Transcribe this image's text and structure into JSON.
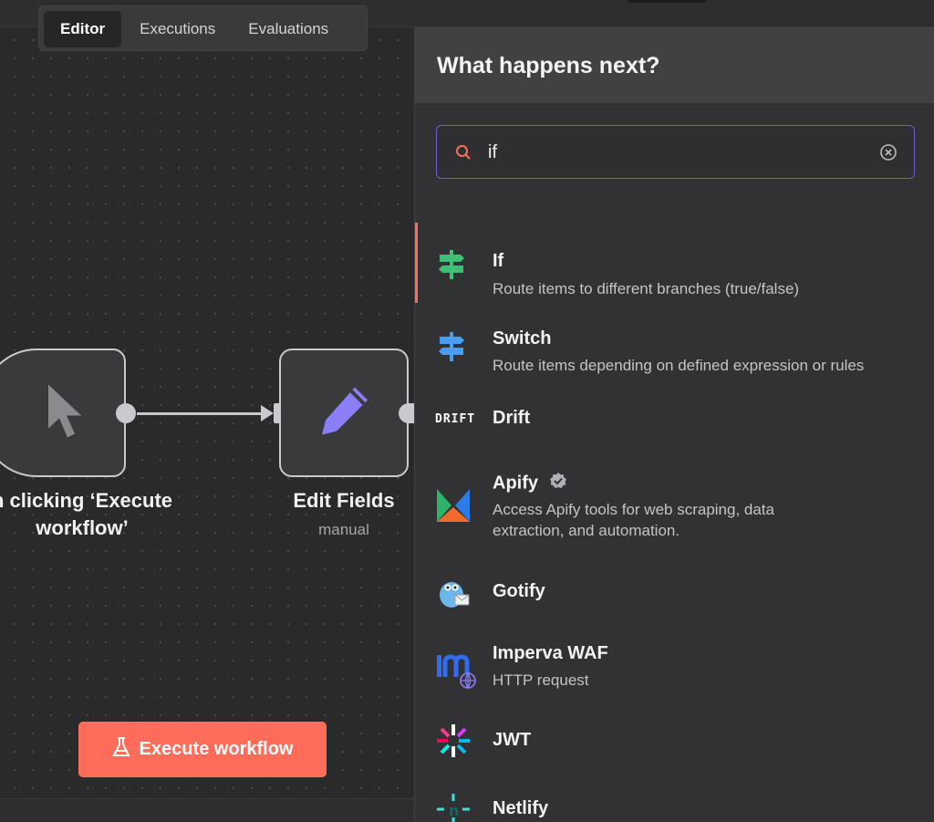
{
  "tabs": [
    {
      "label": "Editor",
      "active": true
    },
    {
      "label": "Executions",
      "active": false
    },
    {
      "label": "Evaluations",
      "active": false
    }
  ],
  "nodes": {
    "trigger": {
      "label_line1": "n clicking ‘Execute",
      "label_line2": "workflow’",
      "icon": "cursor-icon"
    },
    "edit": {
      "label": "Edit Fields",
      "sublabel": "manual",
      "icon": "pencil-icon"
    }
  },
  "execute_button": {
    "label": "Execute workflow",
    "icon": "flask-icon"
  },
  "panel": {
    "title": "What happens next?",
    "search": {
      "value": "if",
      "icon": "search-icon",
      "clear_icon": "clear-icon"
    },
    "items": [
      {
        "name": "If",
        "description": "Route items to different branches (true/false)",
        "icon": "signpost-icon",
        "color": "#3fbf75",
        "selected": true
      },
      {
        "name": "Switch",
        "description": "Route items depending on defined expression or rules",
        "icon": "signpost-icon",
        "color": "#4a9df0"
      },
      {
        "name": "Drift",
        "description": "",
        "icon": "drift-logo-icon",
        "logo_text": "DRIFT"
      },
      {
        "name": "Apify",
        "description": "Access Apify tools for web scraping, data extraction, and automation.",
        "icon": "apify-logo-icon",
        "verified": true
      },
      {
        "name": "Gotify",
        "description": "",
        "icon": "gotify-logo-icon"
      },
      {
        "name": "Imperva WAF",
        "description": "HTTP request",
        "icon": "imperva-logo-icon"
      },
      {
        "name": "JWT",
        "description": "",
        "icon": "jwt-logo-icon"
      },
      {
        "name": "Netlify",
        "description": "",
        "icon": "netlify-logo-icon"
      }
    ]
  },
  "colors": {
    "accent": "#ff6d5a",
    "focus": "#6a5cd8",
    "pencil": "#8b7ef8"
  }
}
